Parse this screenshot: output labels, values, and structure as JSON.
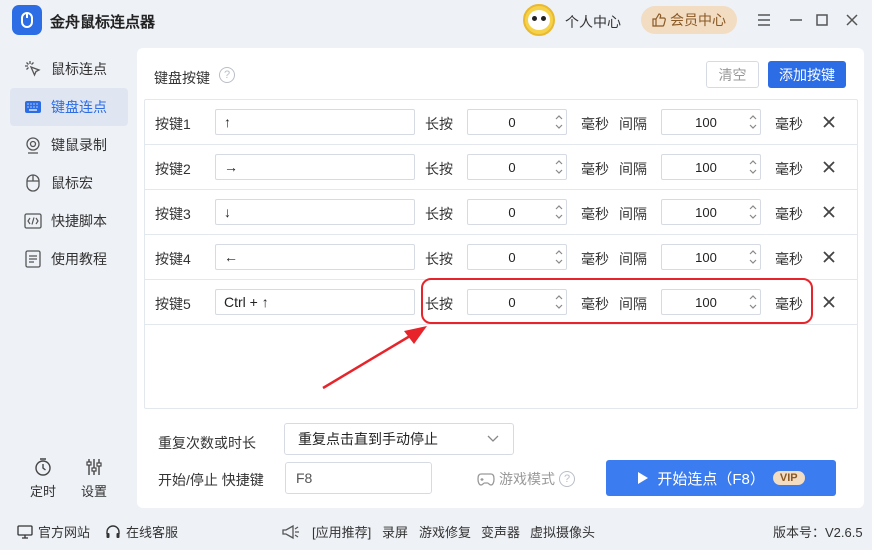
{
  "app": {
    "title": "金舟鼠标连点器"
  },
  "header": {
    "personal_center": "个人中心",
    "vip_center": "会员中心"
  },
  "sidebar": {
    "items": [
      {
        "label": "鼠标连点",
        "icon": "cursor-click-icon",
        "active": false
      },
      {
        "label": "键盘连点",
        "icon": "keyboard-icon",
        "active": true
      },
      {
        "label": "键鼠录制",
        "icon": "record-icon",
        "active": false
      },
      {
        "label": "鼠标宏",
        "icon": "mouse-icon",
        "active": false
      },
      {
        "label": "快捷脚本",
        "icon": "code-icon",
        "active": false
      },
      {
        "label": "使用教程",
        "icon": "tutorial-icon",
        "active": false
      }
    ],
    "timer_label": "定时",
    "settings_label": "设置"
  },
  "main": {
    "title": "键盘按键",
    "clear_label": "清空",
    "add_label": "添加按键",
    "rows": [
      {
        "name": "按键1",
        "key": "↑",
        "press_label": "长按",
        "press_value": "0",
        "unit": "毫秒",
        "interval_label": "间隔",
        "interval_value": "100"
      },
      {
        "name": "按键2",
        "key": "→",
        "press_label": "长按",
        "press_value": "0",
        "unit": "毫秒",
        "interval_label": "间隔",
        "interval_value": "100"
      },
      {
        "name": "按键3",
        "key": "↓",
        "press_label": "长按",
        "press_value": "0",
        "unit": "毫秒",
        "interval_label": "间隔",
        "interval_value": "100"
      },
      {
        "name": "按键4",
        "key": "←",
        "press_label": "长按",
        "press_value": "0",
        "unit": "毫秒",
        "interval_label": "间隔",
        "interval_value": "100"
      },
      {
        "name": "按键5",
        "key": "Ctrl + ↑",
        "press_label": "长按",
        "press_value": "0",
        "unit": "毫秒",
        "interval_label": "间隔",
        "interval_value": "100"
      }
    ],
    "repeat_label": "重复次数或时长",
    "repeat_value": "重复点击直到手动停止",
    "hotkey_label": "开始/停止 快捷键",
    "hotkey_value": "F8",
    "game_mode_label": "游戏模式",
    "start_label": "开始连点（F8）",
    "vip_tag": "VIP"
  },
  "statusbar": {
    "website": "官方网站",
    "support": "在线客服",
    "recommend": "[应用推荐]",
    "links": [
      "录屏",
      "游戏修复",
      "变声器",
      "虚拟摄像头"
    ],
    "version": "版本号：V2.6.5"
  },
  "colors": {
    "accent": "#2c6de6",
    "highlight": "#e8242b",
    "vip": "#f2dcc2"
  }
}
